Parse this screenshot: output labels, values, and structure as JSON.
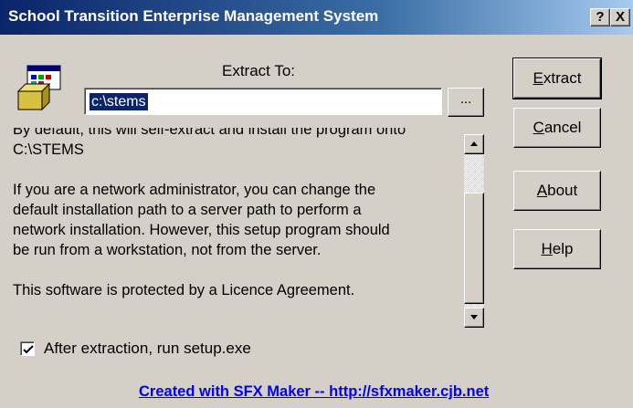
{
  "window": {
    "title": "School Transition Enterprise Management System",
    "help_button": "?",
    "close_button": "X"
  },
  "extract": {
    "label": "Extract To:",
    "path_value": "c:\\stems",
    "browse_label": "..."
  },
  "buttons": {
    "extract": {
      "accel": "E",
      "rest": "xtract"
    },
    "cancel": {
      "accel": "C",
      "rest": "ancel"
    },
    "about": {
      "accel": "A",
      "rest": "bout"
    },
    "help": {
      "accel": "H",
      "rest": "elp"
    }
  },
  "info": {
    "line_clipped": "By default, this will self-extract and install the program onto",
    "line_path": "C:\\STEMS",
    "p2_1": "If you are a network administrator, you can change the",
    "p2_2": "default installation path to a server path to perform a",
    "p2_3": "network installation.  However, this setup program should",
    "p2_4": "be run from a workstation, not from the server.",
    "p3": "This software is protected by a Licence Agreement."
  },
  "checkbox": {
    "checked": true,
    "label": "After extraction,  run  setup.exe"
  },
  "footer": {
    "link": "Created with SFX Maker  --  http://sfxmaker.cjb.net"
  },
  "icons": {
    "installer": "installer-box-icon",
    "scroll_up": "arrow-up-icon",
    "scroll_down": "arrow-down-icon",
    "check": "checkmark-icon"
  }
}
